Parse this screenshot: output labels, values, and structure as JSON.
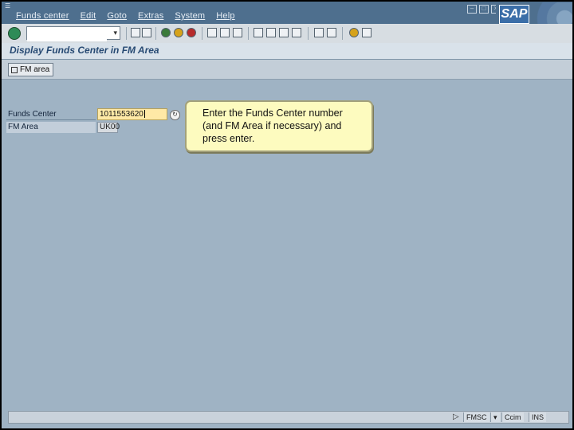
{
  "menubar": {
    "items": [
      "Funds center",
      "Edit",
      "Goto",
      "Extras",
      "System",
      "Help"
    ],
    "brand": "SAP"
  },
  "toolbar": {
    "command_value": "",
    "command_dropdown_icon": "dropdown-icon"
  },
  "title": "Display Funds Center in FM Area",
  "app_toolbar": {
    "fm_area_label": "FM area"
  },
  "form": {
    "funds_center_label": "Funds Center",
    "funds_center_value": "1011553620",
    "fm_area_label": "FM Area",
    "fm_area_value": "UK00"
  },
  "callout": {
    "text": "Enter the Funds Center number (and FM Area if necessary) and press enter."
  },
  "statusbar": {
    "system": "FMSC",
    "server": "Ccim",
    "mode": "INS"
  }
}
